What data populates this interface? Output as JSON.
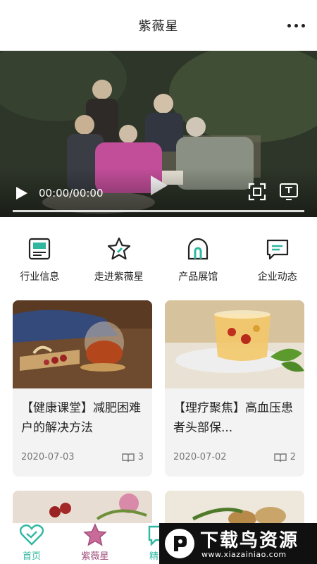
{
  "header": {
    "title": "紫薇星",
    "more_icon": "more-dots-icon"
  },
  "video": {
    "time": "00:00/00:00",
    "progress": 0
  },
  "quicknav": [
    {
      "label": "行业信息",
      "icon": "news-icon"
    },
    {
      "label": "走进紫薇星",
      "icon": "star-icon"
    },
    {
      "label": "产品展馆",
      "icon": "arch-icon"
    },
    {
      "label": "企业动态",
      "icon": "chat-icon"
    }
  ],
  "articles": [
    {
      "title": "【健康课堂】减肥困难户的解决方法",
      "date": "2020-07-03",
      "count": "3"
    },
    {
      "title": "【理疗聚焦】高血压患者头部保...",
      "date": "2020-07-02",
      "count": "2"
    }
  ],
  "tabs": [
    {
      "label": "首页"
    },
    {
      "label": "紫薇星"
    },
    {
      "label": "精品"
    }
  ],
  "watermark": {
    "text": "下载鸟资源",
    "url": "www.xiazainiao.com"
  },
  "colors": {
    "accent": "#2fb7a0",
    "brand": "#a04c7a"
  }
}
